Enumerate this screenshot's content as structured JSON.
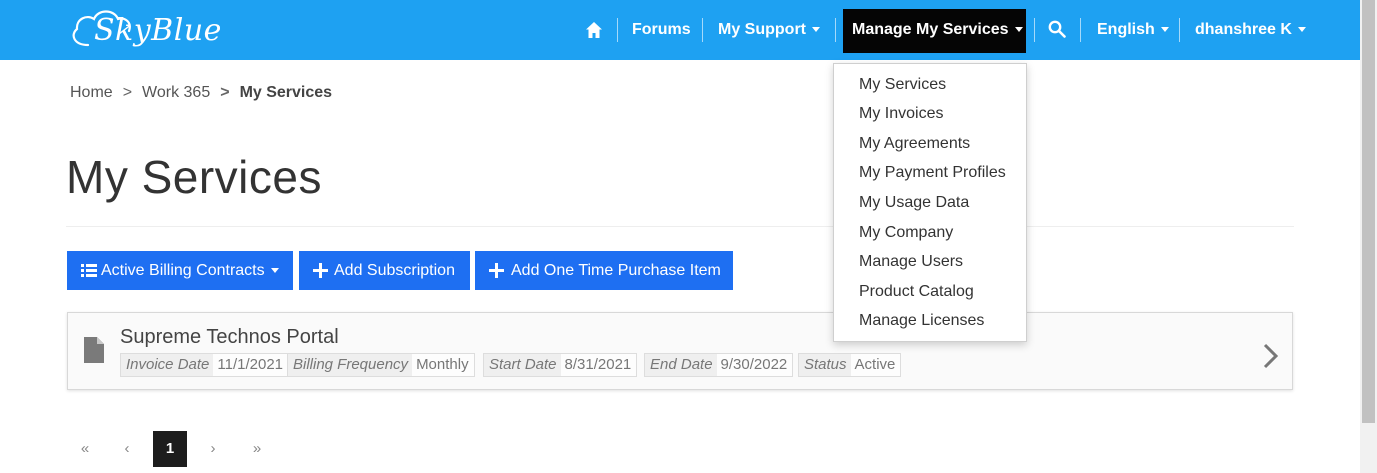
{
  "brand": {
    "name": "SkyBlue",
    "colors": {
      "primary": "#1ea1f2",
      "button": "#1e6ff2",
      "active_nav": "#050505"
    }
  },
  "nav": {
    "home_icon": "home-icon",
    "forums": "Forums",
    "my_support": "My Support",
    "manage_my_services": "Manage My Services",
    "search_icon": "search-icon",
    "language": "English",
    "user": "dhanshree K"
  },
  "dropdown": {
    "items": [
      "My Services",
      "My Invoices",
      "My Agreements",
      "My Payment Profiles",
      "My Usage Data",
      "My Company",
      "Manage Users",
      "Product Catalog",
      "Manage Licenses"
    ]
  },
  "breadcrumb": {
    "items": [
      "Home",
      "Work 365",
      "My Services"
    ],
    "separator": ">"
  },
  "page": {
    "title": "My Services"
  },
  "actions": {
    "billing_contracts": "Active Billing Contracts",
    "add_subscription": "Add Subscription",
    "add_one_time": "Add One Time Purchase Item"
  },
  "services": [
    {
      "name": "Supreme Technos Portal",
      "fields": [
        {
          "label": "Invoice Date",
          "value": "11/1/2021"
        },
        {
          "label": "Billing Frequency",
          "value": "Monthly"
        },
        {
          "label": "Start Date",
          "value": "8/31/2021"
        },
        {
          "label": "End Date",
          "value": "9/30/2022"
        },
        {
          "label": "Status",
          "value": "Active"
        }
      ]
    }
  ],
  "pagination": {
    "first": "«",
    "prev": "‹",
    "current": "1",
    "next": "›",
    "last": "»"
  }
}
